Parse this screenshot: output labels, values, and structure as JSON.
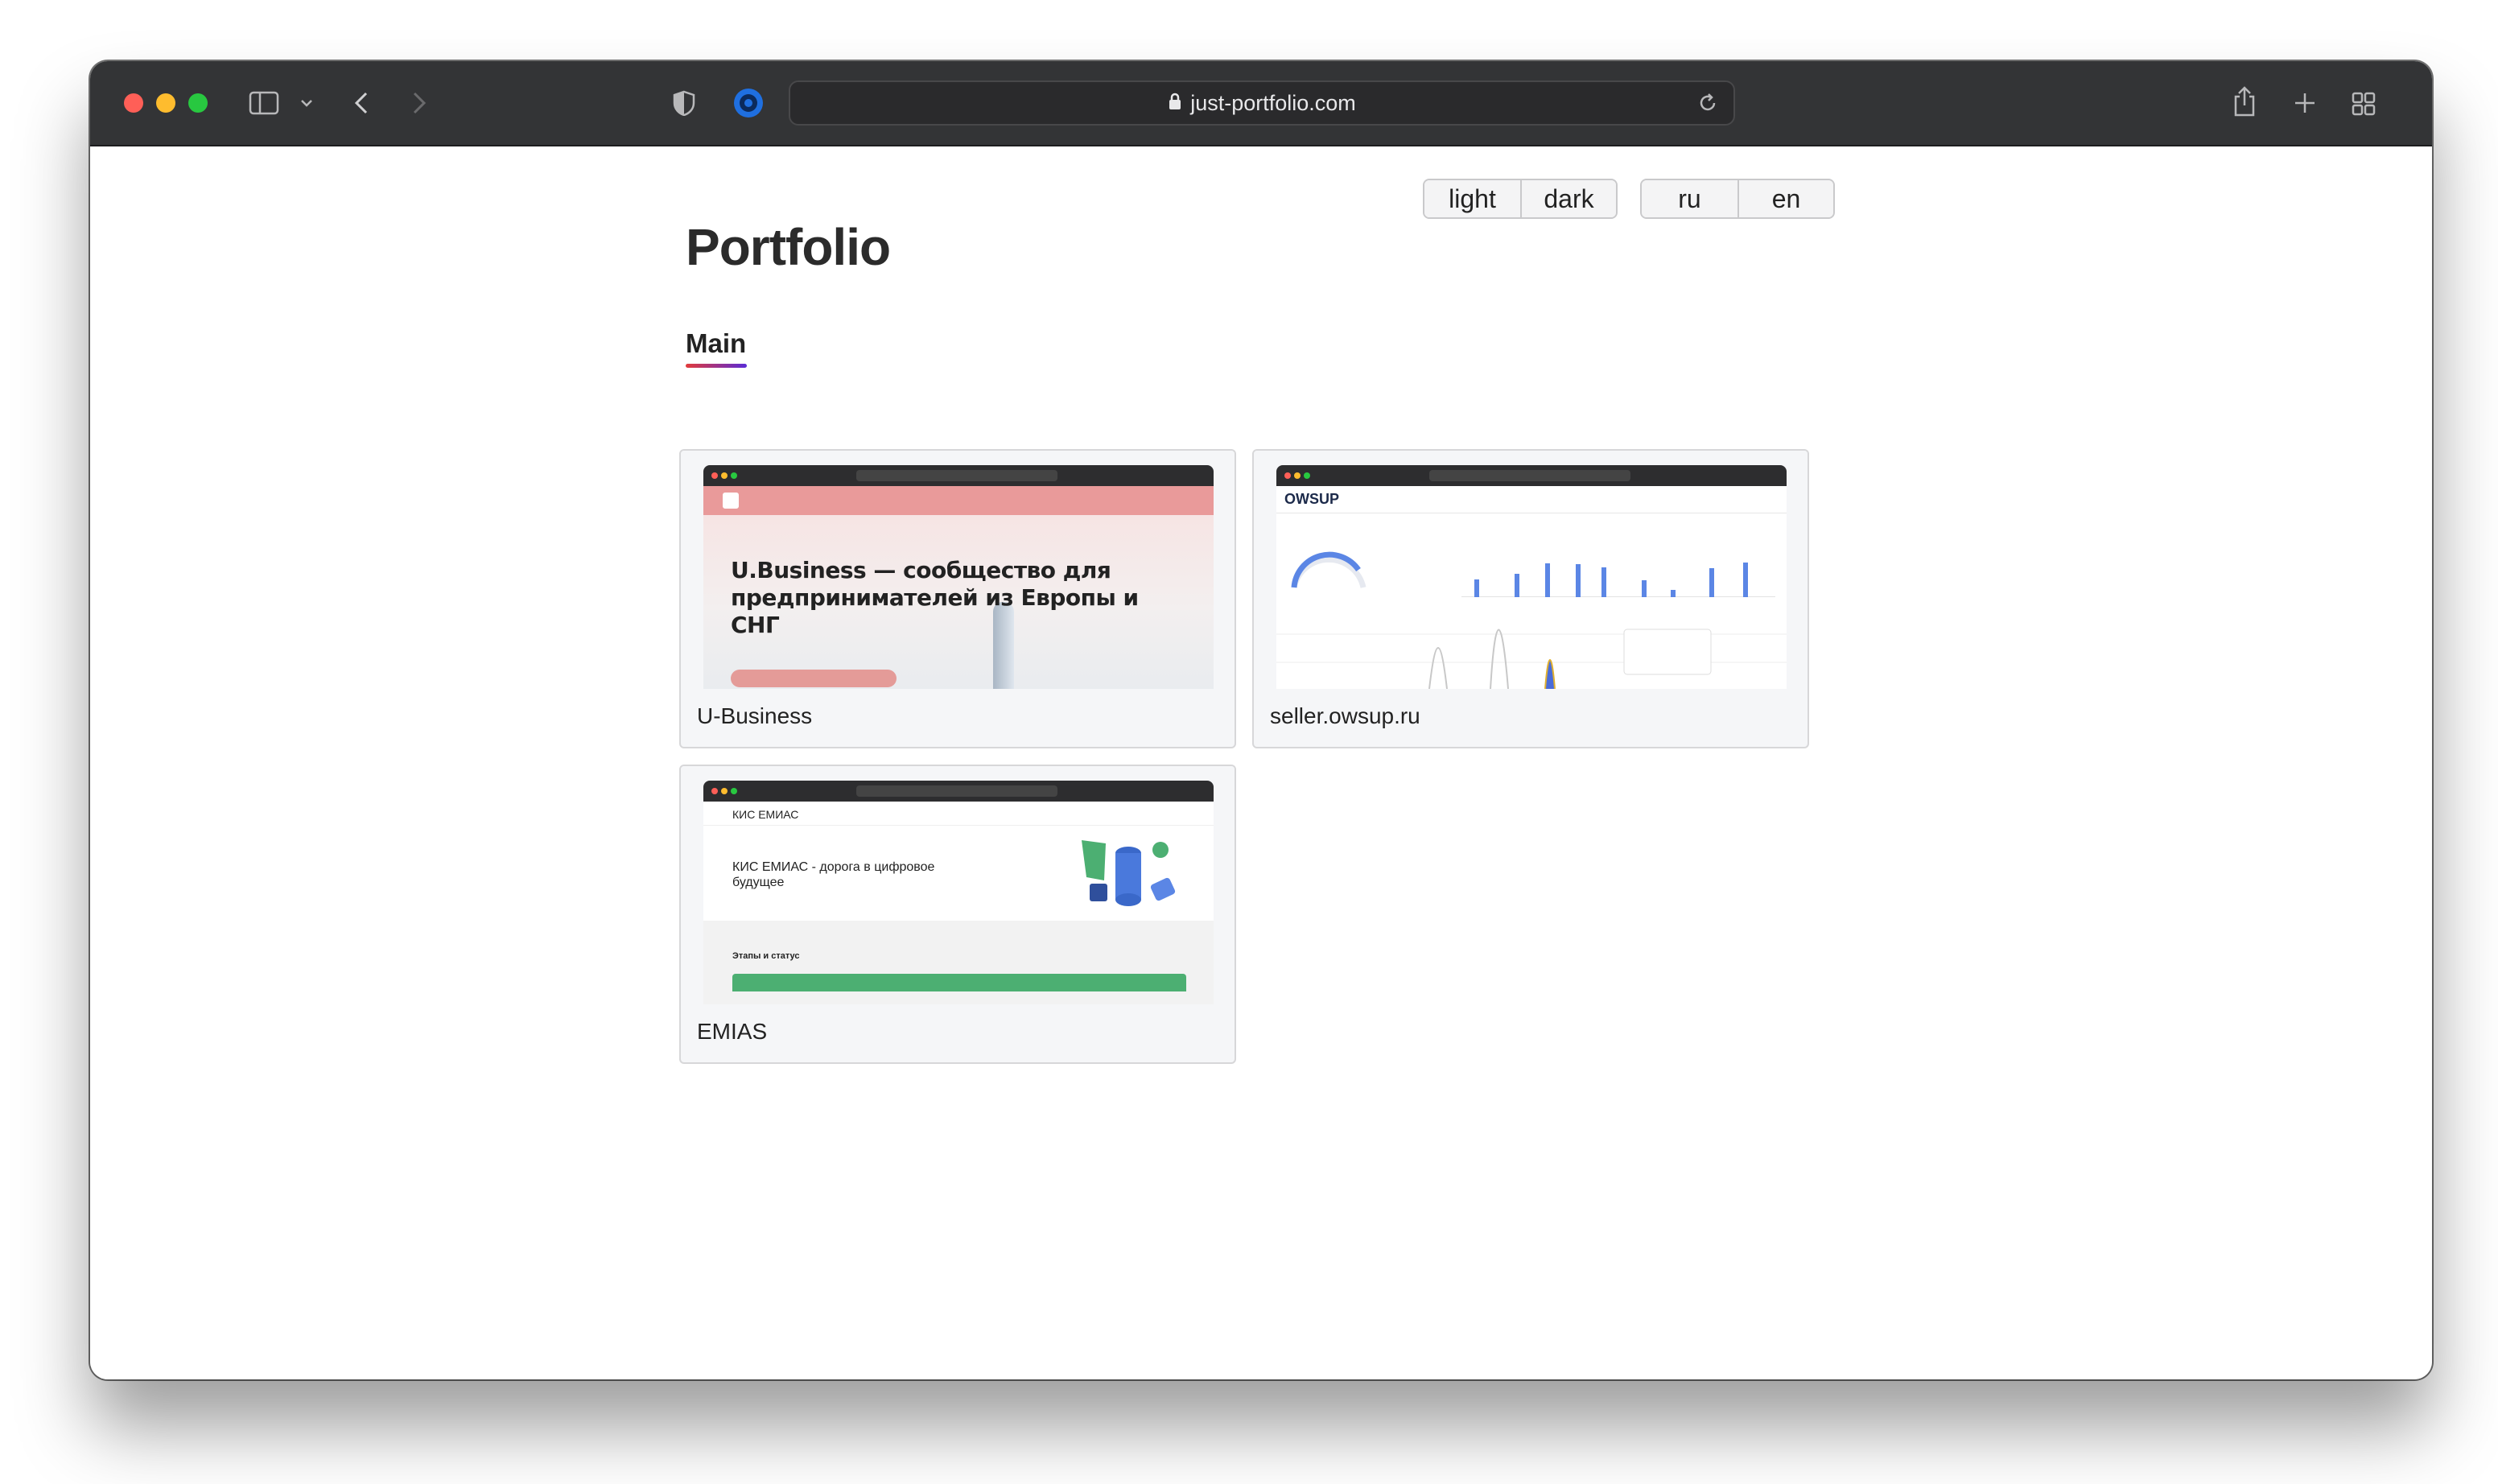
{
  "browser": {
    "url": "just-portfolio.com"
  },
  "toggles": {
    "theme": [
      "light",
      "dark"
    ],
    "lang": [
      "ru",
      "en"
    ]
  },
  "page": {
    "title": "Portfolio",
    "section": "Main"
  },
  "projects": [
    {
      "label": "U-Business",
      "preview_headline": "U.Business — сообщество для предпринимателей из Европы и СНГ",
      "accent": "#e99a9a"
    },
    {
      "label": "seller.owsup.ru",
      "preview_logo": "OWSUP",
      "bar_values": [
        0.42,
        0.55,
        0.8,
        0.78,
        0.72,
        0.4,
        0.18,
        0.7,
        0.82
      ],
      "accent": "#5b86e5"
    },
    {
      "label": "EMIAS",
      "preview_logo": "КИС ЕМИАС",
      "preview_title": "КИС ЕМИАС - дорога в цифровое будущее",
      "preview_section": "Этапы и статус",
      "accent": "#4caf72"
    }
  ],
  "colors": {
    "toolbar": "#333436",
    "section_underline_start": "#e23b3b",
    "section_underline_end": "#5a2bd6"
  }
}
